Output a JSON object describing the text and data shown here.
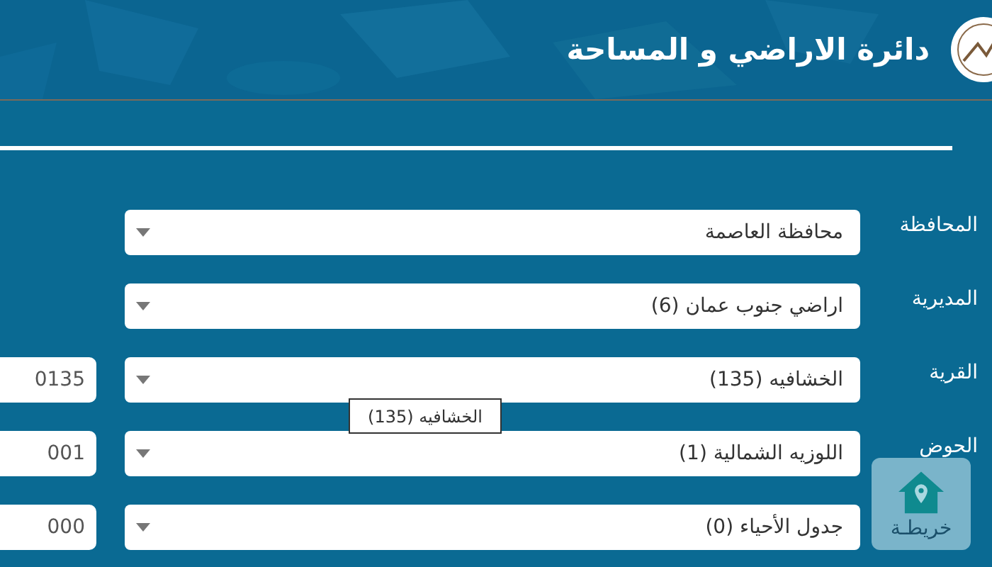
{
  "header": {
    "title": "دائرة الاراضي و المساحة"
  },
  "fields": [
    {
      "label": "المحافظة",
      "value": "محافظة العاصمة"
    },
    {
      "label": "المديرية",
      "value": "اراضي جنوب عمان (6)"
    },
    {
      "label": "القرية",
      "value": "الخشافيه (135)",
      "code": "0135"
    },
    {
      "label": "الحوض",
      "value": "اللوزيه الشمالية (1)",
      "code": "001"
    },
    {
      "value": "جدول الأحياء (0)",
      "code": "000"
    }
  ],
  "tooltip": "الخشافيه (135)",
  "map_button": {
    "label": "خريطـة"
  }
}
